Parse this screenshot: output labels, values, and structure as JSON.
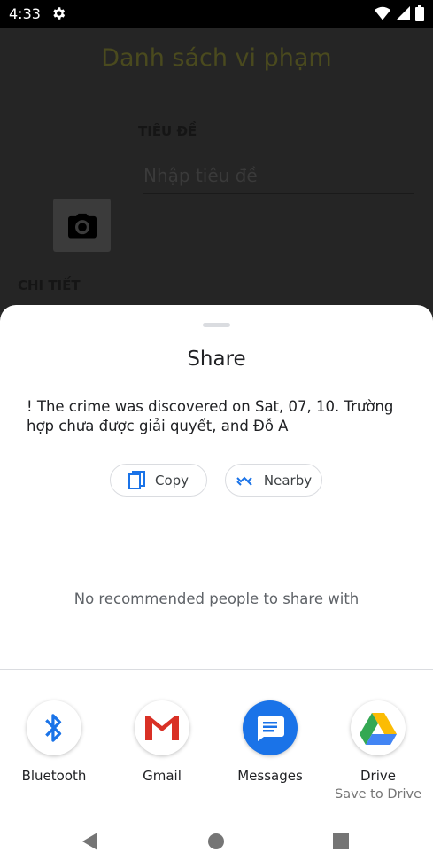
{
  "status_bar": {
    "time": "4:33"
  },
  "app": {
    "title": "Danh sách vi phạm",
    "title_field_label": "TIÊU ĐỀ",
    "title_field_placeholder": "Nhập tiêu đề",
    "detail_label": "CHI TIẾT"
  },
  "share_sheet": {
    "title": "Share",
    "text": "! The crime was discovered on Sat, 07, 10. Trường hợp chưa được giải quyết, and Đỗ A",
    "copy_label": "Copy",
    "nearby_label": "Nearby",
    "no_people_text": "No recommended people to share with",
    "targets": [
      {
        "label": "Bluetooth",
        "icon": "bluetooth-icon"
      },
      {
        "label": "Gmail",
        "icon": "gmail-icon"
      },
      {
        "label": "Messages",
        "icon": "messages-icon"
      },
      {
        "label": "Drive",
        "sublabel": "Save to Drive",
        "icon": "drive-icon"
      }
    ]
  },
  "colors": {
    "accent_blue": "#1a73e8",
    "gmail_red": "#d93025",
    "app_title": "#4a4a1e"
  }
}
